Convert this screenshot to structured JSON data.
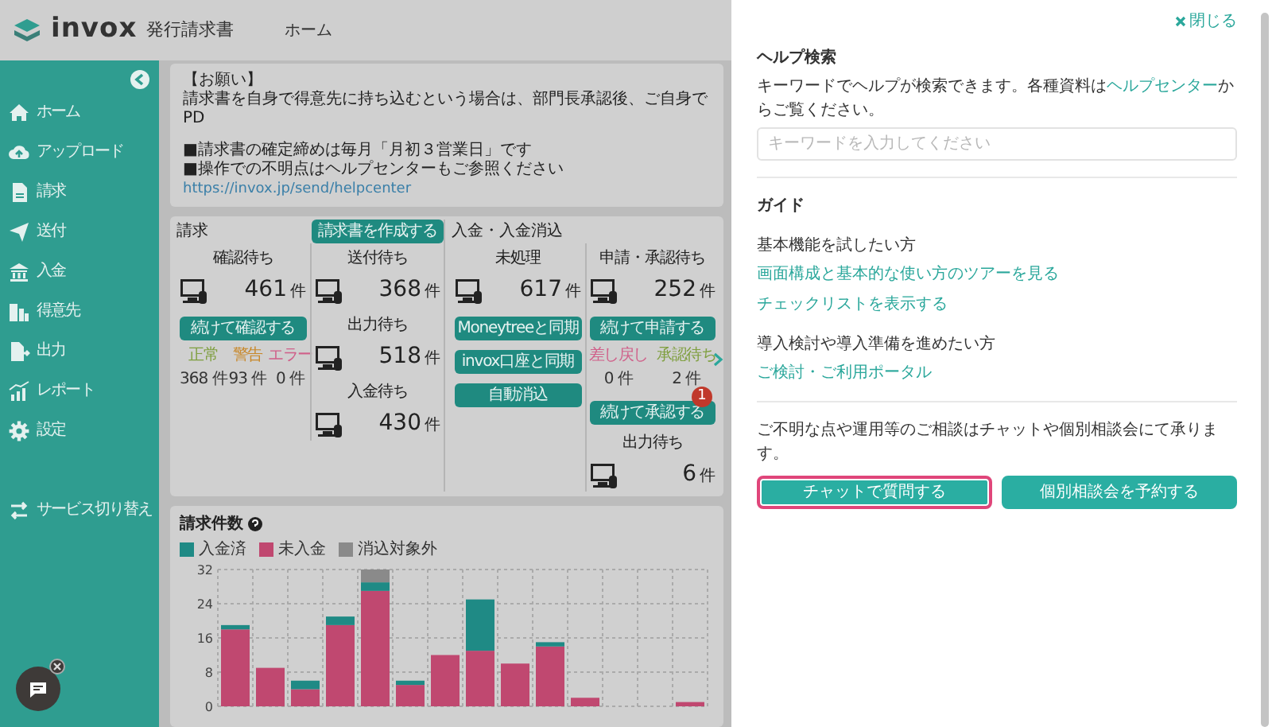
{
  "app": {
    "logo": "invox",
    "product": "発行請求書",
    "breadcrumb": "ホーム"
  },
  "sidebar": {
    "items": [
      {
        "label": "ホーム"
      },
      {
        "label": "アップロード"
      },
      {
        "label": "請求"
      },
      {
        "label": "送付"
      },
      {
        "label": "入金"
      },
      {
        "label": "得意先"
      },
      {
        "label": "出力"
      },
      {
        "label": "レポート"
      },
      {
        "label": "設定"
      }
    ],
    "footer_item": {
      "label": "サービス切り替え"
    }
  },
  "notice": {
    "lines": [
      "【お願い】",
      "請求書を自身で得意先に持ち込むという場合は、部門長承認後、ご自身でPD",
      "■請求書の確定締めは毎月「月初３営業日」です",
      "■操作での不明点はヘルプセンターもご参照ください"
    ],
    "link": "https://invox.jp/send/helpcenter"
  },
  "stats": {
    "sections": [
      {
        "title": "請求",
        "button": "請求書を作成する",
        "columns": [
          [
            {
              "kind": "metric",
              "label": "確認待ち",
              "count": "461",
              "unit": "件"
            },
            {
              "kind": "button",
              "label": "続けて確認する"
            },
            {
              "kind": "statuses",
              "items": [
                {
                  "label": "正常",
                  "count": "368",
                  "unit": "件",
                  "color": "#7f9f3f"
                },
                {
                  "label": "警告",
                  "count": "93",
                  "unit": "件",
                  "color": "#c8882a"
                },
                {
                  "label": "エラー",
                  "count": "0",
                  "unit": "件",
                  "color": "#d0608a"
                }
              ]
            }
          ],
          [
            {
              "kind": "metric",
              "label": "送付待ち",
              "count": "368",
              "unit": "件"
            },
            {
              "kind": "metric",
              "label": "出力待ち",
              "count": "518",
              "unit": "件"
            },
            {
              "kind": "metric",
              "label": "入金待ち",
              "count": "430",
              "unit": "件"
            }
          ]
        ]
      },
      {
        "title": "入金・入金消込",
        "columns": [
          [
            {
              "kind": "metric",
              "label": "未処理",
              "count": "617",
              "unit": "件"
            },
            {
              "kind": "button",
              "label": "Moneytreeと同期"
            },
            {
              "kind": "button",
              "label": "invox口座と同期"
            },
            {
              "kind": "button",
              "label": "自動消込"
            }
          ],
          [
            {
              "kind": "metric",
              "label": "申請・承認待ち",
              "count": "252",
              "unit": "件"
            },
            {
              "kind": "button",
              "label": "続けて申請する"
            },
            {
              "kind": "statuses",
              "items": [
                {
                  "label": "差し戻し",
                  "count": "0",
                  "unit": "件",
                  "color": "#d0608a"
                },
                {
                  "label": "承認待ち",
                  "count": "2",
                  "unit": "件",
                  "color": "#7f9f3f"
                }
              ]
            },
            {
              "kind": "button",
              "label": "続けて承認する",
              "badge": "1"
            },
            {
              "kind": "metric",
              "label": "出力待ち",
              "count": "6",
              "unit": "件"
            }
          ]
        ]
      }
    ]
  },
  "chart": {
    "chart_data": {
      "type": "bar",
      "title": "請求件数",
      "stacked": true,
      "grid": true,
      "ylim": [
        0,
        32
      ],
      "yticks": [
        0,
        8,
        16,
        24,
        32
      ],
      "series": [
        {
          "name": "入金済",
          "color": "#1f8a85",
          "values": [
            1,
            0,
            2,
            2,
            2,
            1,
            0,
            12,
            0,
            1,
            0,
            0,
            0,
            0
          ]
        },
        {
          "name": "未入金",
          "color": "#c04870",
          "values": [
            18,
            9,
            4,
            19,
            27,
            5,
            12,
            13,
            10,
            14,
            2,
            0,
            0,
            1
          ]
        },
        {
          "name": "消込対象外",
          "color": "#8a8a8a",
          "values": [
            0,
            0,
            0,
            0,
            3,
            0,
            0,
            0,
            0,
            0,
            0,
            0,
            0,
            0
          ]
        }
      ]
    }
  },
  "help_panel": {
    "close": "閉じる",
    "search": {
      "title": "ヘルプ検索",
      "text_before": "キーワードでヘルプが検索できます。各種資料は",
      "link": "ヘルプセンター",
      "text_after": "からご覧ください。",
      "placeholder": "キーワードを入力してください"
    },
    "guide": {
      "title": "ガイド",
      "groups": [
        {
          "label": "基本機能を試したい方",
          "links": [
            "画面構成と基本的な使い方のツアーを見る",
            "チェックリストを表示する"
          ]
        },
        {
          "label": "導入検討や導入準備を進めたい方",
          "links": [
            "ご検討・ご利用ポータル"
          ]
        }
      ]
    },
    "contact": {
      "text": "ご不明な点や運用等のご相談はチャットや個別相談会にて承ります。",
      "buttons": [
        {
          "label": "チャットで質問する",
          "focused": true
        },
        {
          "label": "個別相談会を予約する",
          "focused": false
        }
      ]
    }
  }
}
